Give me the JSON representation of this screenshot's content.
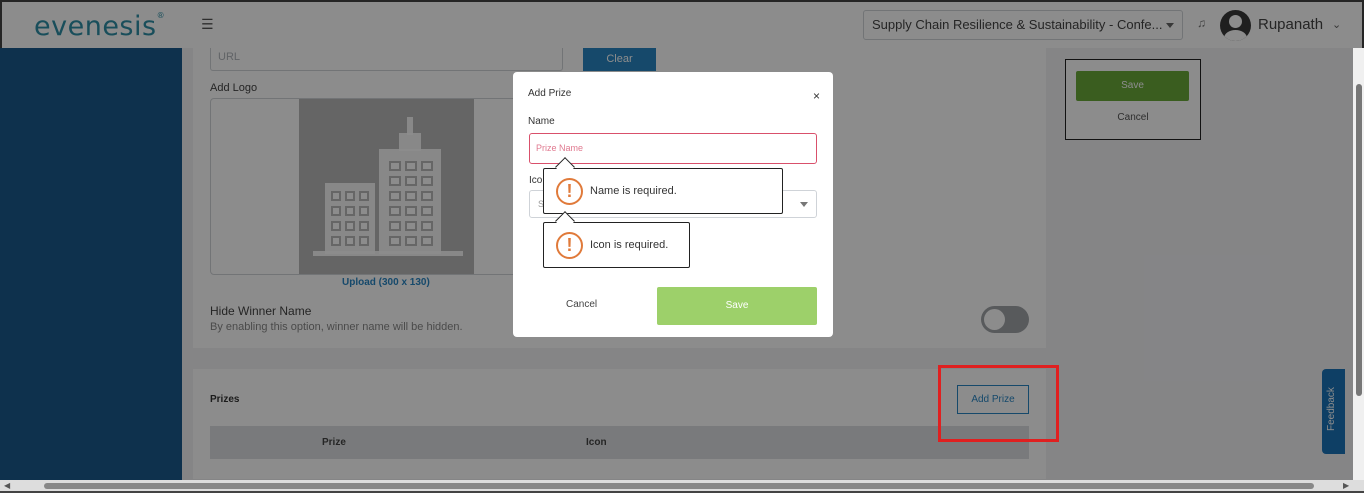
{
  "header": {
    "logo_text": "evenesis",
    "logo_mark": "®",
    "menu_icon": "☰",
    "event_select_value": "Supply Chain Resilience & Sustainability - Confe...",
    "bell_icon": "♫",
    "username": "Rupanath",
    "user_caret": "⌄"
  },
  "settings_form": {
    "url_placeholder": "URL",
    "clear_label": "Clear",
    "add_logo_label": "Add Logo",
    "upload_label": "Upload (300 x 130)",
    "hide_winner_title": "Hide Winner Name",
    "hide_winner_desc": "By enabling this option, winner name will be hidden.",
    "hide_winner_enabled": false
  },
  "right_panel": {
    "save_label": "Save",
    "cancel_label": "Cancel"
  },
  "prizes": {
    "title": "Prizes",
    "add_prize_label": "Add Prize",
    "columns": [
      "Prize",
      "Icon"
    ]
  },
  "modal": {
    "title": "Add Prize",
    "close_icon": "×",
    "name_label": "Name",
    "name_placeholder": "Prize Name",
    "icon_label": "Icon",
    "icon_placeholder": "S",
    "cancel_label": "Cancel",
    "save_label": "Save"
  },
  "errors": {
    "name_error": "Name is required.",
    "icon_error": "Icon is required.",
    "warn_symbol": "!"
  },
  "feedback_label": "Feedback",
  "colors": {
    "sidebar": "#1a5a8c",
    "primary": "#2986c4",
    "save_green": "#6aaa3a",
    "modal_save_green": "#9dd06a",
    "error_red": "#d9506b",
    "highlight_red": "#e02020"
  }
}
